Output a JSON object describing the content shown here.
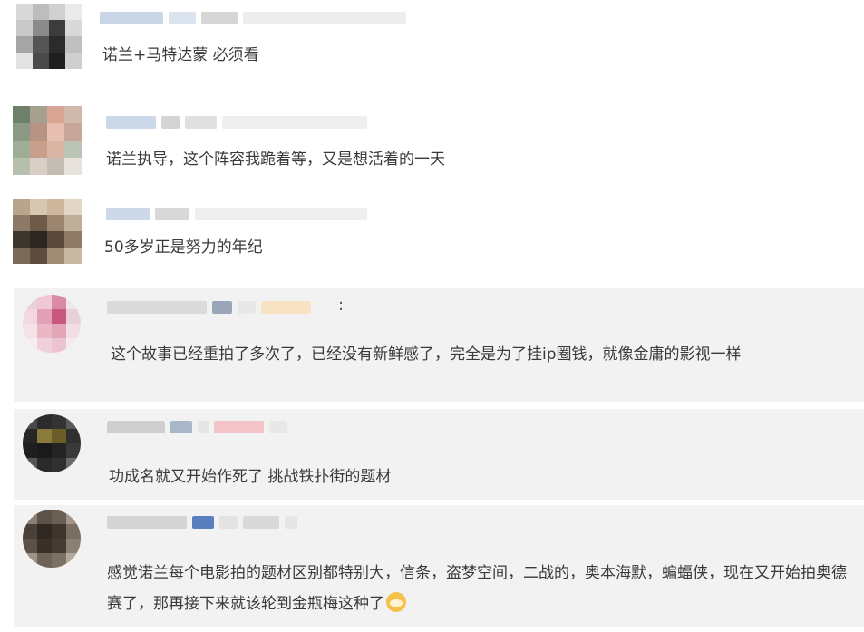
{
  "comments": [
    {
      "text": "诺兰+马特达蒙 必须看"
    },
    {
      "text": "诺兰执导，这个阵容我跪着等，又是想活着的一天"
    },
    {
      "text": "50多岁正是努力的年纪"
    },
    {
      "text": "这个故事已经重拍了多次了，已经没有新鲜感了，完全是为了挂ip圈钱，就像金庸的影视一样",
      "menu": ":"
    },
    {
      "text": "功成名就又开始作死了 挑战铁扑街的题材"
    },
    {
      "text": "感觉诺兰每个电影拍的题材区别都特别大，信条，盗梦空间，二战的，奥本海默，蝙蝠侠，现在又开始拍奥德赛了，那再接下来就该轮到金瓶梅这种了"
    }
  ],
  "colors": {
    "page_bg": "#ffffff",
    "card_bg": "#f2f2f2",
    "text": "#3a3a3a"
  },
  "icons": {
    "emoji": "dog-face-emoji-icon"
  }
}
